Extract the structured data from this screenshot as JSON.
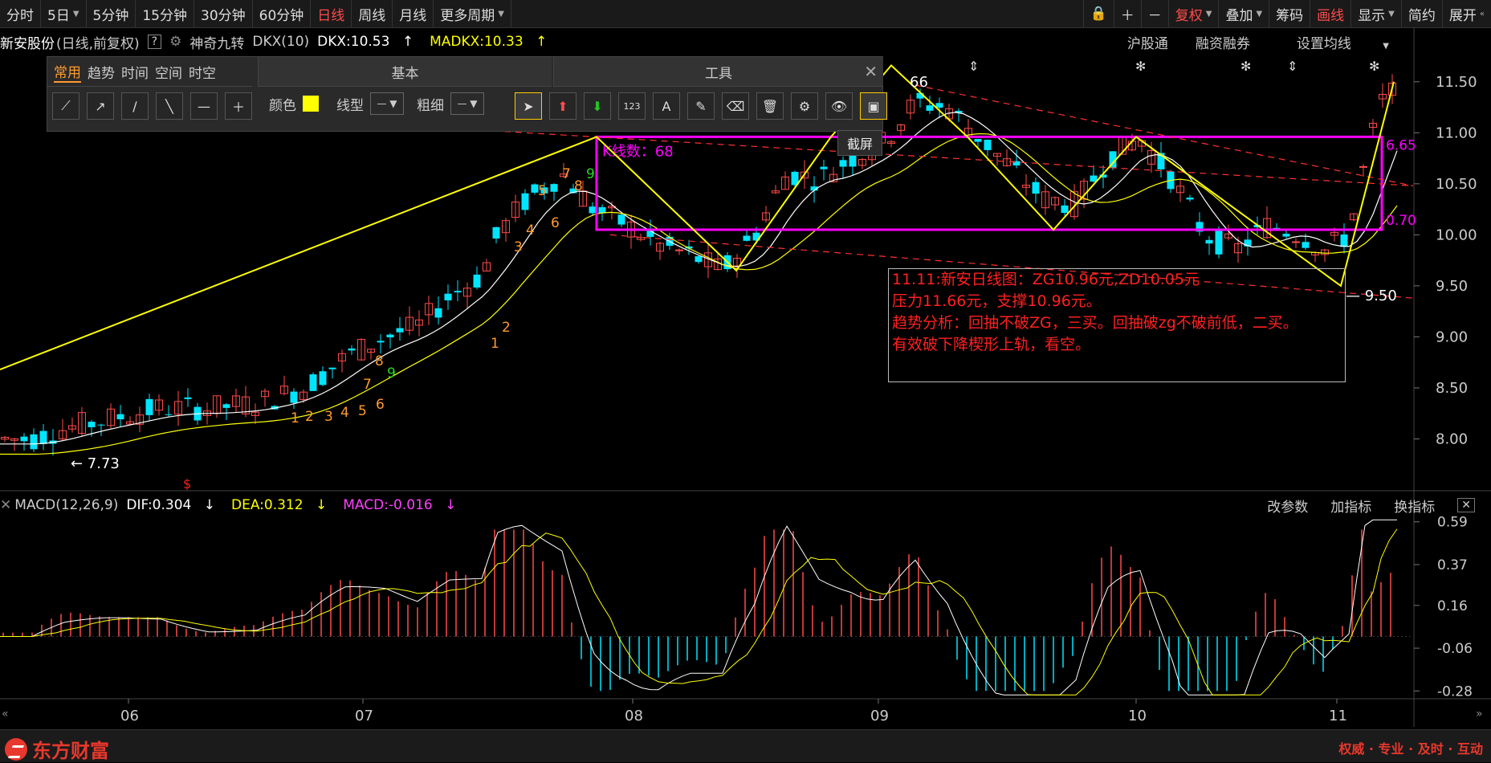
{
  "toolbar": {
    "periods": [
      "分时",
      "5日",
      "5分钟",
      "15分钟",
      "30分钟",
      "60分钟",
      "日线",
      "周线",
      "月线",
      "更多周期"
    ],
    "active_period": "日线",
    "right": [
      "复权",
      "叠加",
      "筹码",
      "画线",
      "显示",
      "简约",
      "展开"
    ]
  },
  "info": {
    "stock_name": "新安股份",
    "mode": "(日线,前复权)",
    "help": "?",
    "indicator": "神奇九转",
    "dkx_param": "DKX(10)",
    "dkx": "DKX:10.53",
    "madkx": "MADKX:10.33",
    "right": [
      "沪股通",
      "融资融券",
      "设置均线"
    ]
  },
  "draw_panel": {
    "tabs": [
      "常用",
      "趋势",
      "时间",
      "空间",
      "时空"
    ],
    "active_tab": "常用",
    "sections": [
      "基本",
      "工具"
    ],
    "labels": {
      "color": "颜色",
      "line_type": "线型",
      "thickness": "粗细"
    },
    "tooltip": "截屏"
  },
  "annotation": {
    "lines": [
      "11.11:新安日线图：ZG10.96元,ZD10.05元",
      "压力11.66元，支撑10.96元。",
      "趋势分析：回抽不破ZG，三买。回抽破zg不破前低，二买。",
      "有效破下降楔形上轨，看空。"
    ],
    "box_label": "K线数：68",
    "low_label": "7.73",
    "low_label2": "9.50",
    "top_label": "66",
    "right_label1": "6.65",
    "right_label2": "0.70"
  },
  "macd": {
    "name": "MACD(12,26,9)",
    "dif": "DIF:0.304",
    "dea": "DEA:0.312",
    "macd": "MACD:-0.016",
    "right": [
      "改参数",
      "加指标",
      "换指标"
    ]
  },
  "bottom": {
    "brand": "东方财富",
    "slogan": "权威 · 专业 · 及时 · 互动"
  },
  "chart_data": [
    {
      "type": "candlestick",
      "title": "",
      "x_ticks": [
        "06",
        "07",
        "08",
        "09",
        "10",
        "11"
      ],
      "y_ticks": [
        8.0,
        8.5,
        9.0,
        9.5,
        10.0,
        10.5,
        11.0,
        11.5
      ],
      "ylim": [
        7.5,
        11.75
      ],
      "series": [
        {
          "name": "DKX",
          "color": "#ffffff"
        },
        {
          "name": "MADKX",
          "color": "#ffff00"
        }
      ],
      "zs_box": {
        "zg": 10.96,
        "zd": 10.05
      },
      "nine_turn_labels": [
        "1",
        "2",
        "3",
        "4",
        "5",
        "6",
        "7",
        "8",
        "9",
        "3",
        "4",
        "5",
        "6",
        "7",
        "8",
        "9",
        "1",
        "2",
        "7",
        "8",
        "9"
      ],
      "colors": {
        "up": "#ff4b4b",
        "down": "#00e5ff",
        "zs_box": "#ff00ff",
        "trend": "#ffff00",
        "channel": "#ff3030"
      }
    },
    {
      "type": "macd",
      "y_ticks": [
        0.59,
        0.37,
        0.16,
        -0.06,
        -0.28
      ],
      "ylim": [
        -0.32,
        0.63
      ],
      "series": [
        {
          "name": "DIF",
          "color": "#ffffff"
        },
        {
          "name": "DEA",
          "color": "#ffff00"
        }
      ]
    }
  ]
}
